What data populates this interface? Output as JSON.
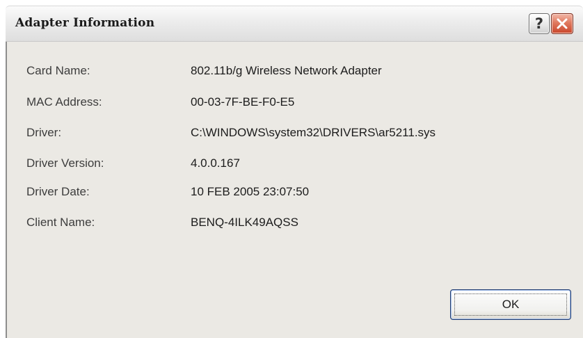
{
  "window": {
    "title": "Adapter Information",
    "help_label": "?",
    "close_icon": "close-x-icon"
  },
  "fields": [
    {
      "label": "Card Name:",
      "value": "802.11b/g Wireless Network Adapter"
    },
    {
      "label": "MAC Address:",
      "value": "00-03-7F-BE-F0-E5"
    },
    {
      "label": "Driver:",
      "value": "C:\\WINDOWS\\system32\\DRIVERS\\ar5211.sys"
    },
    {
      "label": "Driver Version:",
      "value": "4.0.0.167"
    },
    {
      "label": "Driver Date:",
      "value": "10 FEB 2005 23:07:50"
    },
    {
      "label": "Client Name:",
      "value": "BENQ-4ILK49AQSS"
    }
  ],
  "buttons": {
    "ok_label": "OK"
  },
  "colors": {
    "dialog_background": "#ebe9e4",
    "close_button": "#d05a3c",
    "ok_border": "#1f3a6e"
  }
}
